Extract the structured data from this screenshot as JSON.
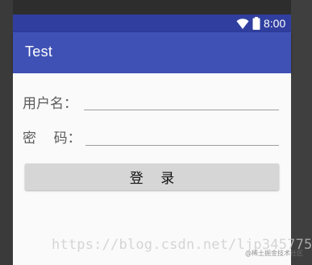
{
  "status_bar": {
    "time": "8:00",
    "icons": [
      "wifi-icon",
      "battery-icon"
    ]
  },
  "app_bar": {
    "title": "Test",
    "color": "#3f51b5"
  },
  "form": {
    "username_label": "用户名：",
    "username_value": "",
    "password_label": "密    码：",
    "password_value": "",
    "login_button_label": "登    录"
  },
  "watermark": {
    "url": "https://blog.csdn.net/ljp345775",
    "badge": "@稀土掘金技术社区"
  },
  "colors": {
    "status_bar": "#303f9f",
    "primary": "#3f51b5",
    "background": "#fafafa",
    "button": "#d6d6d6"
  }
}
